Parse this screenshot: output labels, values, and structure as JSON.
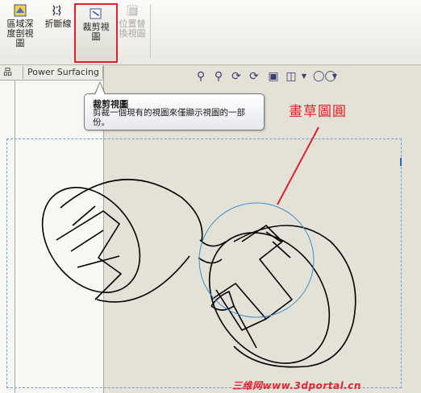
{
  "toolbar": {
    "buttons": [
      {
        "label": "區域深\n度剖視\n圖"
      },
      {
        "label": "折斷線"
      },
      {
        "label": "裁剪視\n圖"
      },
      {
        "label": "位置替\n換視圖"
      }
    ]
  },
  "tabs": {
    "left_partial": "品",
    "power_surfacing": "Power Surfacing"
  },
  "tooltip": {
    "title": "裁剪視圖",
    "body": "剪裁一個現有的視圖來僅顯示視圖的一部份。"
  },
  "annotation": {
    "text": "畫草圖圓"
  },
  "watermark": {
    "text": "三维网www.3dportal.cn"
  },
  "view_tools": [
    "zoom-to-fit-icon",
    "zoom-area-icon",
    "previous-view-icon",
    "rotate-icon",
    "view-orientation-icon",
    "display-style-icon",
    "hide-show-icon"
  ],
  "colors": {
    "highlight_red": "#e0202a",
    "sketch_circle": "#3a8fd0",
    "sheet_border": "#6aa0d8",
    "background": "#e4e2d6"
  }
}
